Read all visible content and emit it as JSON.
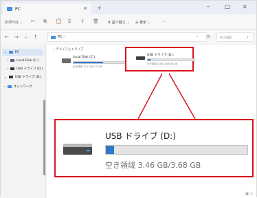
{
  "window": {
    "tab_title": "PC",
    "tab_close": "×",
    "new_tab": "+",
    "minimize": "–",
    "maximize": "□",
    "close": "×"
  },
  "toolbar": {
    "new_label": "新規作成 ⌄",
    "sort_label": "⇅ 並べ替え ⌄",
    "view_label": "☰ 表示 ⌄",
    "more_label": "···"
  },
  "address": {
    "back": "←",
    "forward": "→",
    "up_history": "⌄",
    "up": "↑",
    "path": "PC ›",
    "dropdown": "⌄",
    "refresh": "⟳",
    "search_placeholder": "PCの検索"
  },
  "sidebar": {
    "items": [
      {
        "label": "PC",
        "chevron": "⌄"
      },
      {
        "label": "Local Disk (C:)",
        "chevron": "›"
      },
      {
        "label": "USB ドライブ (D:)",
        "chevron": "›"
      },
      {
        "label": "USB ドライブ (D:)",
        "chevron": "⌄"
      },
      {
        "label": "ネットワーク",
        "chevron": "›"
      }
    ]
  },
  "content": {
    "group_header": "⌄ デバイスとドライブ",
    "drives": [
      {
        "name": "Local Disk (C:)",
        "free": "空き領域 104 GB/237 GB",
        "used_fraction": 0.56
      },
      {
        "name": "USB ドライブ (D:)",
        "free": "空き領域 3.46 GB/3.68 GB",
        "used_fraction": 0.06
      }
    ]
  },
  "zoom": {
    "name": "USB ドライブ (D:)",
    "free": "空き領域 3.46 GB/3.68 GB",
    "used_fraction": 0.06
  },
  "statusbar": {
    "icons": "▦ ▭"
  },
  "colors": {
    "accent": "#2d79c7",
    "highlight": "#d8151e"
  }
}
